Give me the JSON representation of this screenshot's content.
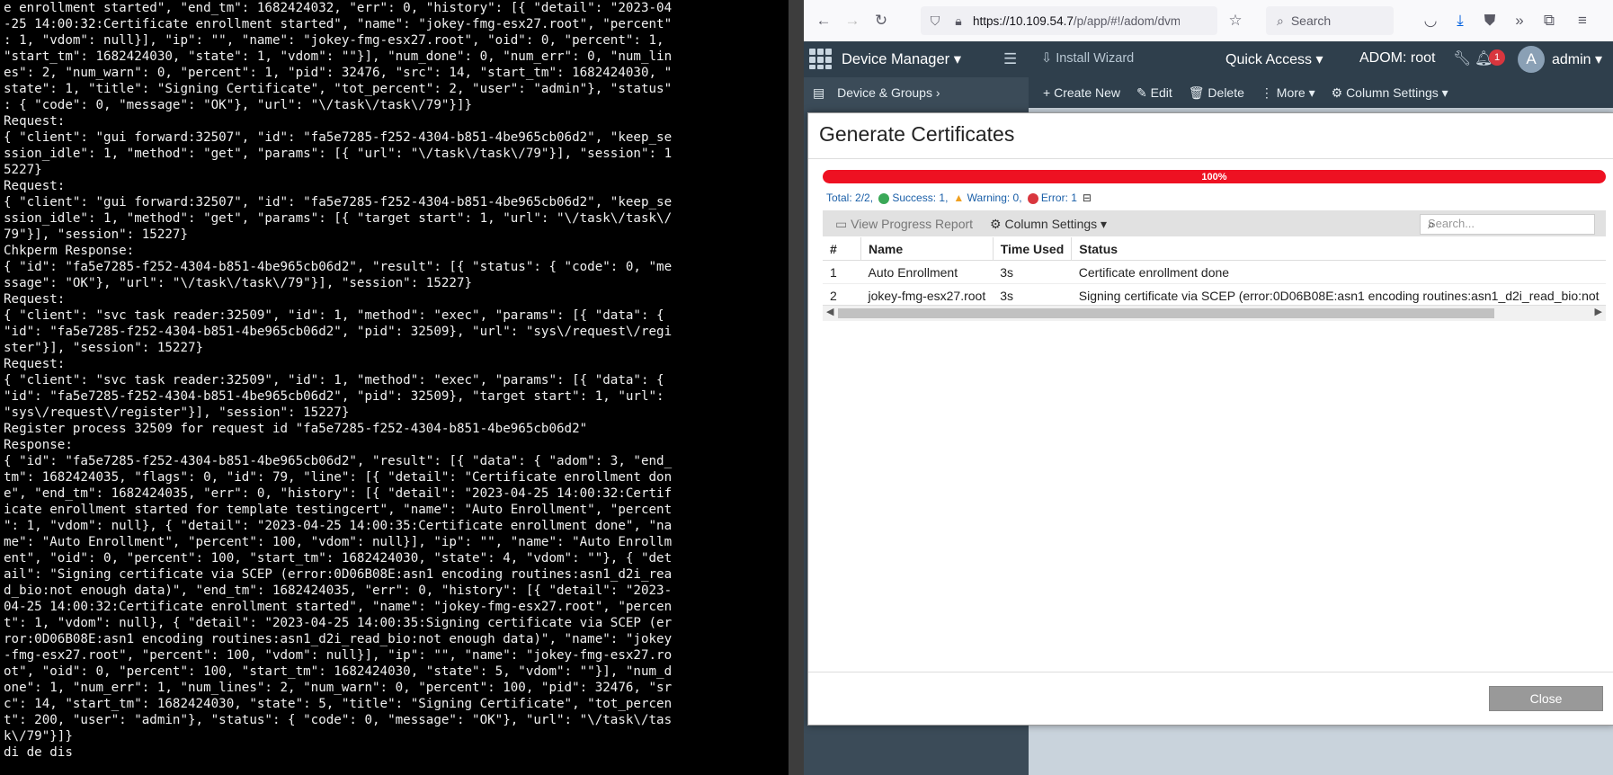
{
  "terminal": {
    "lines": [
      "e enrollment started\", \"end_tm\": 1682424032, \"err\": 0, \"history\": [{ \"detail\": \"2023-04",
      "-25 14:00:32:Certificate enrollment started\", \"name\": \"jokey-fmg-esx27.root\", \"percent\"",
      ": 1, \"vdom\": null}], \"ip\": \"\", \"name\": \"jokey-fmg-esx27.root\", \"oid\": 0, \"percent\": 1,",
      "\"start_tm\": 1682424030, \"state\": 1, \"vdom\": \"\"}], \"num_done\": 0, \"num_err\": 0, \"num_lin",
      "es\": 2, \"num_warn\": 0, \"percent\": 1, \"pid\": 32476, \"src\": 14, \"start_tm\": 1682424030, \"",
      "state\": 1, \"title\": \"Signing Certificate\", \"tot_percent\": 2, \"user\": \"admin\"}, \"status\"",
      ": { \"code\": 0, \"message\": \"OK\"}, \"url\": \"\\/task\\/task\\/79\"}]}",
      "Request:",
      "{ \"client\": \"gui forward:32507\", \"id\": \"fa5e7285-f252-4304-b851-4be965cb06d2\", \"keep_se",
      "ssion_idle\": 1, \"method\": \"get\", \"params\": [{ \"url\": \"\\/task\\/task\\/79\"}], \"session\": 1",
      "5227}",
      "Request:",
      "{ \"client\": \"gui forward:32507\", \"id\": \"fa5e7285-f252-4304-b851-4be965cb06d2\", \"keep_se",
      "ssion_idle\": 1, \"method\": \"get\", \"params\": [{ \"target start\": 1, \"url\": \"\\/task\\/task\\/",
      "79\"}], \"session\": 15227}",
      "Chkperm Response:",
      "{ \"id\": \"fa5e7285-f252-4304-b851-4be965cb06d2\", \"result\": [{ \"status\": { \"code\": 0, \"me",
      "ssage\": \"OK\"}, \"url\": \"\\/task\\/task\\/79\"}], \"session\": 15227}",
      "Request:",
      "{ \"client\": \"svc task reader:32509\", \"id\": 1, \"method\": \"exec\", \"params\": [{ \"data\": {",
      "\"id\": \"fa5e7285-f252-4304-b851-4be965cb06d2\", \"pid\": 32509}, \"url\": \"sys\\/request\\/regi",
      "ster\"}], \"session\": 15227}",
      "Request:",
      "{ \"client\": \"svc task reader:32509\", \"id\": 1, \"method\": \"exec\", \"params\": [{ \"data\": {",
      "\"id\": \"fa5e7285-f252-4304-b851-4be965cb06d2\", \"pid\": 32509}, \"target start\": 1, \"url\":",
      "\"sys\\/request\\/register\"}], \"session\": 15227}",
      "Register process 32509 for request id \"fa5e7285-f252-4304-b851-4be965cb06d2\"",
      "Response:",
      "{ \"id\": \"fa5e7285-f252-4304-b851-4be965cb06d2\", \"result\": [{ \"data\": { \"adom\": 3, \"end_",
      "tm\": 1682424035, \"flags\": 0, \"id\": 79, \"line\": [{ \"detail\": \"Certificate enrollment don",
      "e\", \"end_tm\": 1682424035, \"err\": 0, \"history\": [{ \"detail\": \"2023-04-25 14:00:32:Certif",
      "icate enrollment started for template testingcert\", \"name\": \"Auto Enrollment\", \"percent",
      "\": 1, \"vdom\": null}, { \"detail\": \"2023-04-25 14:00:35:Certificate enrollment done\", \"na",
      "me\": \"Auto Enrollment\", \"percent\": 100, \"vdom\": null}], \"ip\": \"\", \"name\": \"Auto Enrollm",
      "ent\", \"oid\": 0, \"percent\": 100, \"start_tm\": 1682424030, \"state\": 4, \"vdom\": \"\"}, { \"det",
      "ail\": \"Signing certificate via SCEP (error:0D06B08E:asn1 encoding routines:asn1_d2i_rea",
      "d_bio:not enough data)\", \"end_tm\": 1682424035, \"err\": 0, \"history\": [{ \"detail\": \"2023-",
      "04-25 14:00:32:Certificate enrollment started\", \"name\": \"jokey-fmg-esx27.root\", \"percen",
      "t\": 1, \"vdom\": null}, { \"detail\": \"2023-04-25 14:00:35:Signing certificate via SCEP (er",
      "ror:0D06B08E:asn1 encoding routines:asn1_d2i_read_bio:not enough data)\", \"name\": \"jokey",
      "-fmg-esx27.root\", \"percent\": 100, \"vdom\": null}], \"ip\": \"\", \"name\": \"jokey-fmg-esx27.ro",
      "ot\", \"oid\": 0, \"percent\": 100, \"start_tm\": 1682424030, \"state\": 5, \"vdom\": \"\"}], \"num_d",
      "one\": 1, \"num_err\": 1, \"num_lines\": 2, \"num_warn\": 0, \"percent\": 100, \"pid\": 32476, \"sr",
      "c\": 14, \"start_tm\": 1682424030, \"state\": 5, \"title\": \"Signing Certificate\", \"tot_percen",
      "t\": 200, \"user\": \"admin\"}, \"status\": { \"code\": 0, \"message\": \"OK\"}, \"url\": \"\\/task\\/tas",
      "k\\/79\"}]}",
      "di de dis"
    ]
  },
  "browser": {
    "url_host": "https://10.109.54.7",
    "url_path": "/p/app/#!/adom/dvm/ma",
    "search_placeholder": "Search"
  },
  "app": {
    "title": "Device Manager",
    "install_wizard": "Install Wizard",
    "quick_access": "Quick Access",
    "adom": "ADOM: root",
    "notification_count": "1",
    "avatar_letter": "A",
    "user": "admin",
    "device_groups": "Device & Groups",
    "actions": [
      "Create New",
      "Edit",
      "Delete",
      "More",
      "Column Settings"
    ]
  },
  "modal": {
    "title": "Generate Certificates",
    "progress_label": "100%",
    "progress_fraction": 1.0,
    "total": "Total: 2/2,",
    "success": "Success: 1,",
    "warning": "Warning: 0,",
    "error": "Error: 1",
    "view_progress": "View Progress Report",
    "column_settings": "Column Settings",
    "search_placeholder": "Search...",
    "columns": [
      "#",
      "Name",
      "Time Used",
      "Status"
    ],
    "rows": [
      [
        "1",
        "Auto Enrollment",
        "3s",
        "Certificate enrollment done"
      ],
      [
        "2",
        "jokey-fmg-esx27.root",
        "3s",
        "Signing certificate via SCEP (error:0D06B08E:asn1 encoding routines:asn1_d2i_read_bio:not"
      ]
    ],
    "close": "Close"
  },
  "colors": {
    "terminal_bg": "#000000",
    "progress": "#ee1122",
    "header": "#2f3f4c"
  }
}
